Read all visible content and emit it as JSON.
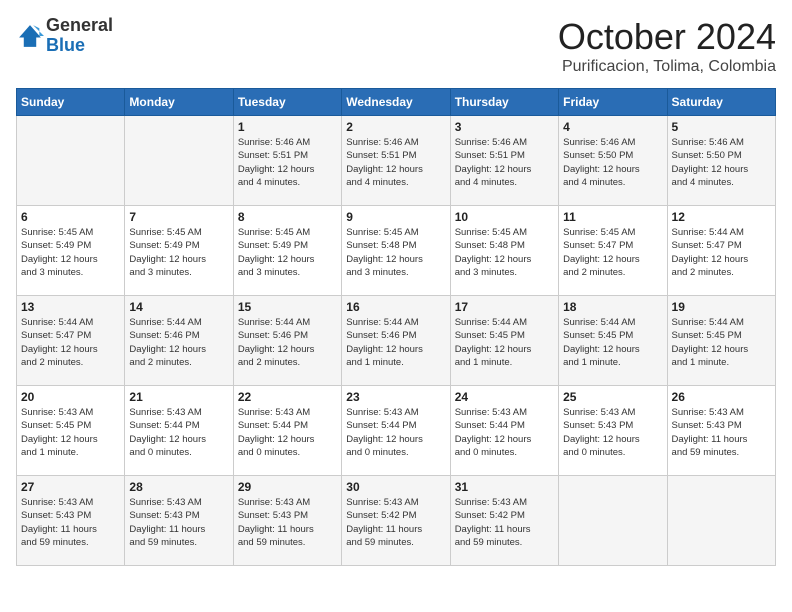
{
  "header": {
    "logo_general": "General",
    "logo_blue": "Blue",
    "month_title": "October 2024",
    "location": "Purificacion, Tolima, Colombia"
  },
  "weekdays": [
    "Sunday",
    "Monday",
    "Tuesday",
    "Wednesday",
    "Thursday",
    "Friday",
    "Saturday"
  ],
  "weeks": [
    [
      {
        "day": "",
        "info": ""
      },
      {
        "day": "",
        "info": ""
      },
      {
        "day": "1",
        "info": "Sunrise: 5:46 AM\nSunset: 5:51 PM\nDaylight: 12 hours\nand 4 minutes."
      },
      {
        "day": "2",
        "info": "Sunrise: 5:46 AM\nSunset: 5:51 PM\nDaylight: 12 hours\nand 4 minutes."
      },
      {
        "day": "3",
        "info": "Sunrise: 5:46 AM\nSunset: 5:51 PM\nDaylight: 12 hours\nand 4 minutes."
      },
      {
        "day": "4",
        "info": "Sunrise: 5:46 AM\nSunset: 5:50 PM\nDaylight: 12 hours\nand 4 minutes."
      },
      {
        "day": "5",
        "info": "Sunrise: 5:46 AM\nSunset: 5:50 PM\nDaylight: 12 hours\nand 4 minutes."
      }
    ],
    [
      {
        "day": "6",
        "info": "Sunrise: 5:45 AM\nSunset: 5:49 PM\nDaylight: 12 hours\nand 3 minutes."
      },
      {
        "day": "7",
        "info": "Sunrise: 5:45 AM\nSunset: 5:49 PM\nDaylight: 12 hours\nand 3 minutes."
      },
      {
        "day": "8",
        "info": "Sunrise: 5:45 AM\nSunset: 5:49 PM\nDaylight: 12 hours\nand 3 minutes."
      },
      {
        "day": "9",
        "info": "Sunrise: 5:45 AM\nSunset: 5:48 PM\nDaylight: 12 hours\nand 3 minutes."
      },
      {
        "day": "10",
        "info": "Sunrise: 5:45 AM\nSunset: 5:48 PM\nDaylight: 12 hours\nand 3 minutes."
      },
      {
        "day": "11",
        "info": "Sunrise: 5:45 AM\nSunset: 5:47 PM\nDaylight: 12 hours\nand 2 minutes."
      },
      {
        "day": "12",
        "info": "Sunrise: 5:44 AM\nSunset: 5:47 PM\nDaylight: 12 hours\nand 2 minutes."
      }
    ],
    [
      {
        "day": "13",
        "info": "Sunrise: 5:44 AM\nSunset: 5:47 PM\nDaylight: 12 hours\nand 2 minutes."
      },
      {
        "day": "14",
        "info": "Sunrise: 5:44 AM\nSunset: 5:46 PM\nDaylight: 12 hours\nand 2 minutes."
      },
      {
        "day": "15",
        "info": "Sunrise: 5:44 AM\nSunset: 5:46 PM\nDaylight: 12 hours\nand 2 minutes."
      },
      {
        "day": "16",
        "info": "Sunrise: 5:44 AM\nSunset: 5:46 PM\nDaylight: 12 hours\nand 1 minute."
      },
      {
        "day": "17",
        "info": "Sunrise: 5:44 AM\nSunset: 5:45 PM\nDaylight: 12 hours\nand 1 minute."
      },
      {
        "day": "18",
        "info": "Sunrise: 5:44 AM\nSunset: 5:45 PM\nDaylight: 12 hours\nand 1 minute."
      },
      {
        "day": "19",
        "info": "Sunrise: 5:44 AM\nSunset: 5:45 PM\nDaylight: 12 hours\nand 1 minute."
      }
    ],
    [
      {
        "day": "20",
        "info": "Sunrise: 5:43 AM\nSunset: 5:45 PM\nDaylight: 12 hours\nand 1 minute."
      },
      {
        "day": "21",
        "info": "Sunrise: 5:43 AM\nSunset: 5:44 PM\nDaylight: 12 hours\nand 0 minutes."
      },
      {
        "day": "22",
        "info": "Sunrise: 5:43 AM\nSunset: 5:44 PM\nDaylight: 12 hours\nand 0 minutes."
      },
      {
        "day": "23",
        "info": "Sunrise: 5:43 AM\nSunset: 5:44 PM\nDaylight: 12 hours\nand 0 minutes."
      },
      {
        "day": "24",
        "info": "Sunrise: 5:43 AM\nSunset: 5:44 PM\nDaylight: 12 hours\nand 0 minutes."
      },
      {
        "day": "25",
        "info": "Sunrise: 5:43 AM\nSunset: 5:43 PM\nDaylight: 12 hours\nand 0 minutes."
      },
      {
        "day": "26",
        "info": "Sunrise: 5:43 AM\nSunset: 5:43 PM\nDaylight: 11 hours\nand 59 minutes."
      }
    ],
    [
      {
        "day": "27",
        "info": "Sunrise: 5:43 AM\nSunset: 5:43 PM\nDaylight: 11 hours\nand 59 minutes."
      },
      {
        "day": "28",
        "info": "Sunrise: 5:43 AM\nSunset: 5:43 PM\nDaylight: 11 hours\nand 59 minutes."
      },
      {
        "day": "29",
        "info": "Sunrise: 5:43 AM\nSunset: 5:43 PM\nDaylight: 11 hours\nand 59 minutes."
      },
      {
        "day": "30",
        "info": "Sunrise: 5:43 AM\nSunset: 5:42 PM\nDaylight: 11 hours\nand 59 minutes."
      },
      {
        "day": "31",
        "info": "Sunrise: 5:43 AM\nSunset: 5:42 PM\nDaylight: 11 hours\nand 59 minutes."
      },
      {
        "day": "",
        "info": ""
      },
      {
        "day": "",
        "info": ""
      }
    ]
  ]
}
